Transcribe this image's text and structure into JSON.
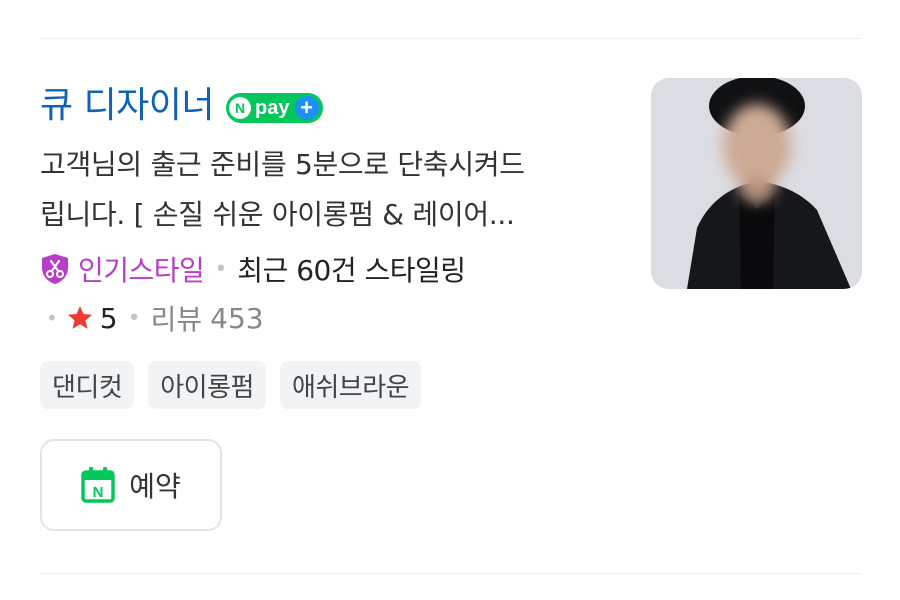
{
  "listing": {
    "title": "큐 디자이너",
    "npay": {
      "n_label": "N",
      "pay_label": "pay",
      "plus_label": "+"
    },
    "description": {
      "line1": "고객님의 출근 준비를 5분으로 단축시켜드",
      "line2": "립니다. [ 손질 쉬운 아이롱펌 & 레이어..."
    },
    "popular_label": "인기스타일",
    "separator": "•",
    "recent_styling": "최근 60건 스타일링",
    "rating": "5",
    "review_label": "리뷰",
    "review_count": "453",
    "tags": [
      "댄디컷",
      "아이롱펌",
      "애쉬브라운"
    ],
    "reserve_label": "예약",
    "calendar_letter": "N"
  },
  "colors": {
    "title": "#0f63b4",
    "npay_green": "#03c75a",
    "npay_plus_blue": "#1e8ff5",
    "popular_purple": "#b73fc6",
    "star_red": "#ee3b2f",
    "calendar_green": "#03c75a"
  },
  "icons": {
    "popular": "shield-scissors-icon",
    "star": "star-icon",
    "calendar": "calendar-icon"
  }
}
